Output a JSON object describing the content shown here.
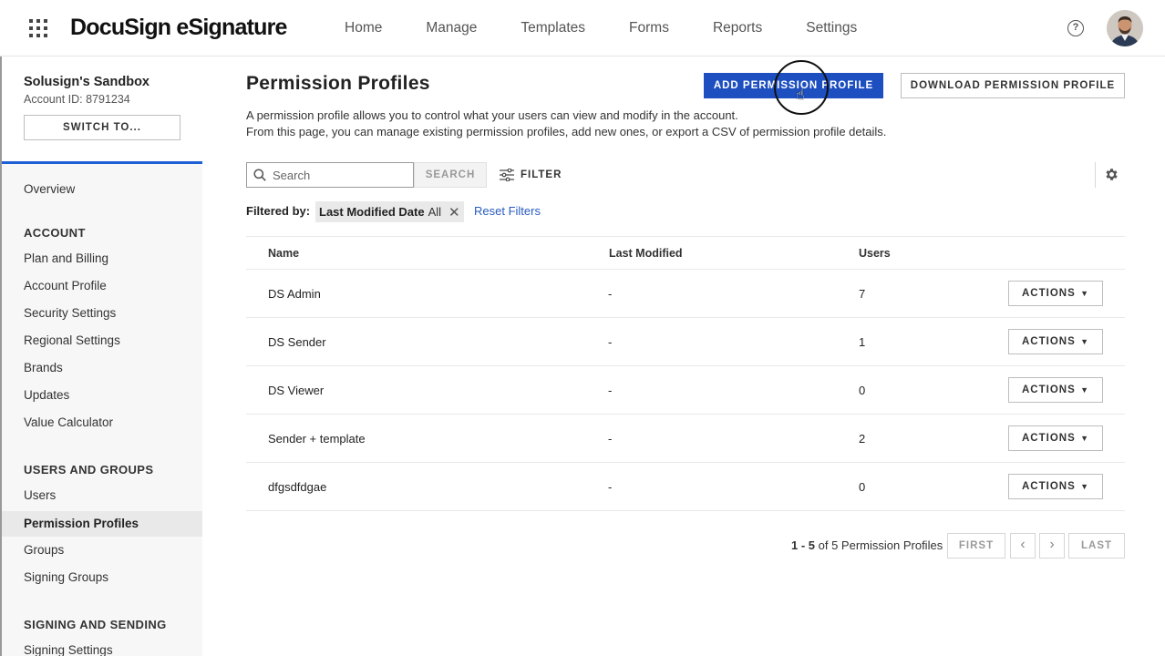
{
  "header": {
    "logo": "DocuSign eSignature",
    "nav": [
      "Home",
      "Manage",
      "Templates",
      "Forms",
      "Reports",
      "Settings"
    ],
    "help_icon": "help-circle-icon",
    "avatar_icon": "user-avatar"
  },
  "sidebar": {
    "account_name": "Solusign's Sandbox",
    "account_id": "Account ID: 8791234",
    "switch_label": "SWITCH TO...",
    "overview": "Overview",
    "account_heading": "ACCOUNT",
    "account_items": [
      "Plan and Billing",
      "Account Profile",
      "Security Settings",
      "Regional Settings",
      "Brands",
      "Updates",
      "Value Calculator"
    ],
    "users_heading": "USERS AND GROUPS",
    "users_items": [
      "Users",
      "Permission Profiles",
      "Groups",
      "Signing Groups"
    ],
    "signing_heading": "SIGNING AND SENDING",
    "signing_items": [
      "Signing Settings"
    ]
  },
  "main": {
    "title": "Permission Profiles",
    "add_button": "ADD PERMISSION PROFILE",
    "download_button": "DOWNLOAD PERMISSION PROFILE",
    "desc_line1": "A permission profile allows you to control what your users can view and modify in the account.",
    "desc_line2": "From this page, you can manage existing permission profiles, add new ones, or export a CSV of permission profile details.",
    "search_placeholder": "Search",
    "search_button": "SEARCH",
    "filter_button": "FILTER",
    "filtered_by": "Filtered by:",
    "chip_key": "Last Modified Date",
    "chip_value": "All",
    "reset_filters": "Reset Filters"
  },
  "table": {
    "columns": [
      "Name",
      "Last Modified",
      "Users"
    ],
    "action_label": "ACTIONS",
    "rows": [
      {
        "name": "DS Admin",
        "modified": "-",
        "users": "7"
      },
      {
        "name": "DS Sender",
        "modified": "-",
        "users": "1"
      },
      {
        "name": "DS Viewer",
        "modified": "-",
        "users": "0"
      },
      {
        "name": "Sender + template",
        "modified": "-",
        "users": "2"
      },
      {
        "name": "dfgsdfdgae",
        "modified": "-",
        "users": "0"
      }
    ]
  },
  "pagination": {
    "range": "1 - 5",
    "summary": "of 5 Permission Profiles",
    "first": "FIRST",
    "last": "LAST"
  },
  "colors": {
    "primary": "#1e4fc0",
    "link": "#2a5cc0",
    "sidebar_accent": "#1f5fd6"
  }
}
